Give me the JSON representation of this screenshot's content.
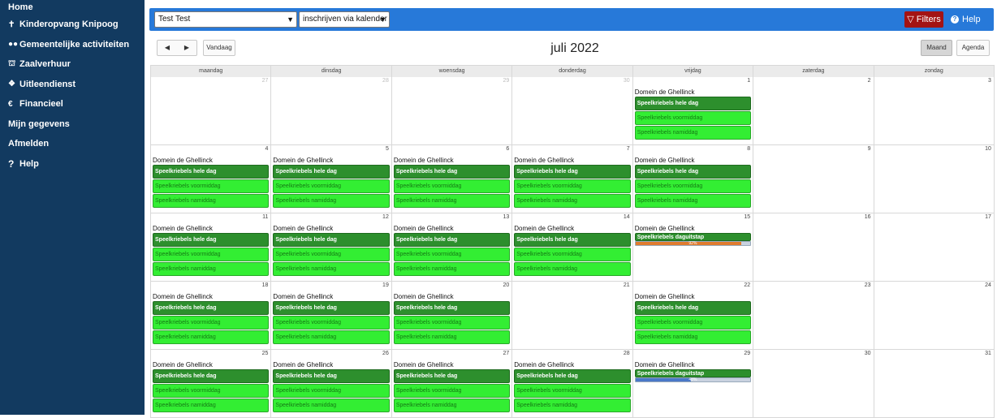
{
  "sidebar": {
    "items": [
      {
        "label": "Home",
        "icon": ""
      },
      {
        "label": "Kinderopvang Knipoog",
        "icon": "child-icon"
      },
      {
        "label": "Gemeentelijke activiteiten",
        "icon": "users-icon"
      },
      {
        "label": "Zaalverhuur",
        "icon": "building-icon"
      },
      {
        "label": "Uitleendienst",
        "icon": "handshake-icon"
      },
      {
        "label": "Financieel",
        "icon": "euro-icon"
      },
      {
        "label": "Mijn gegevens",
        "icon": ""
      },
      {
        "label": "Afmelden",
        "icon": ""
      },
      {
        "label": "Help",
        "icon": "question-icon"
      }
    ]
  },
  "toolbar": {
    "user_select": "Test Test",
    "mode_select": "inschrijven via kalender",
    "filters_label": "Filters",
    "help_label": "Help",
    "today_label": "Vandaag",
    "month_label": "Maand",
    "agenda_label": "Agenda",
    "title": "juli 2022"
  },
  "calendar": {
    "weekdays": [
      "maandag",
      "dinsdag",
      "woensdag",
      "donderdag",
      "vrijdag",
      "zaterdag",
      "zondag"
    ],
    "location": "Domein de Ghellinck",
    "ev_full": "Speelkriebels hele dag",
    "ev_morning": "Speelkriebels voormiddag",
    "ev_afternoon": "Speelkriebels namiddag",
    "ev_trip": "Speelkriebels daguitstap",
    "trip_15_percent": "92%",
    "trip_29_percent": "48%"
  },
  "colors": {
    "sidebar_bg": "#123a60",
    "topbar_bg": "#2779d9",
    "filters_bg": "#a31313",
    "event_dark": "#2d8f2d",
    "event_light": "#33ee33",
    "progress_orange": "#e07b2e",
    "progress_blue": "#4a78c8"
  }
}
